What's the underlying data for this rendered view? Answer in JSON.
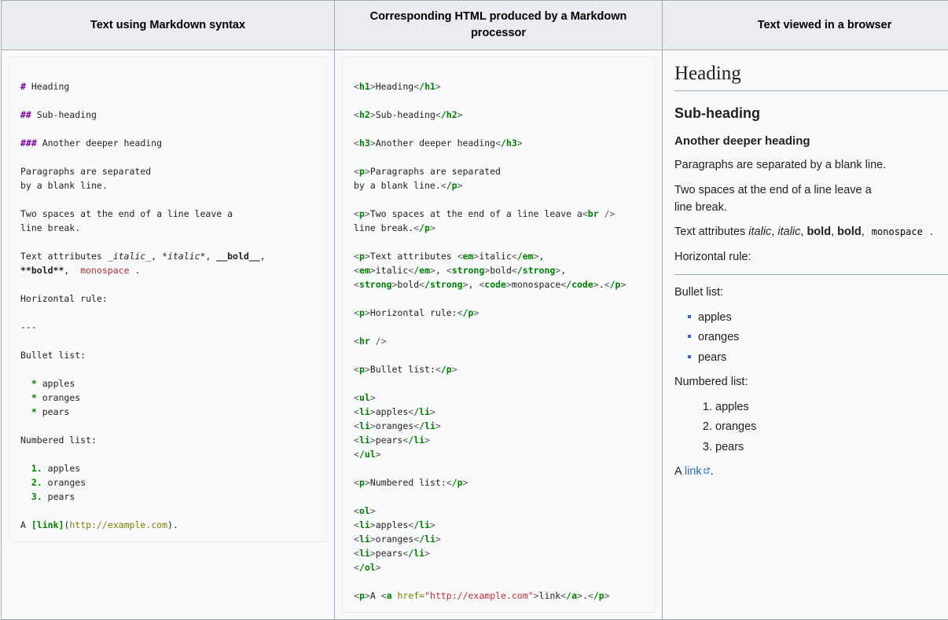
{
  "table": {
    "headers": [
      "Text using Markdown syntax",
      "Corresponding HTML produced by a Markdown processor",
      "Text viewed in a browser"
    ]
  },
  "markdown_source": {
    "heading_h1_marker": "#",
    "heading_h1_text": " Heading",
    "heading_h2_marker": "##",
    "heading_h2_text": " Sub-heading",
    "heading_h3_marker": "###",
    "heading_h3_text": " Another deeper heading",
    "para1_line1": "Paragraphs are separated",
    "para1_line2": "by a blank line.",
    "para2_line1": "Two spaces at the end of a line leave a",
    "para2_line2": "line break.",
    "attrs_prefix": "Text attributes ",
    "attrs_italic_underscore": "_italic_",
    "attrs_sep1": ", ",
    "attrs_italic_star": "*italic*",
    "attrs_sep2": ", ",
    "attrs_bold_underscore": "__bold__",
    "attrs_sep3": ",",
    "attrs_bold_star": "**bold**",
    "attrs_sep4": ", ",
    "attrs_tick_open": "`",
    "attrs_monospace": "monospace",
    "attrs_tick_close": "`",
    "attrs_end": ".",
    "hr_label": "Horizontal rule:",
    "hr_marker": "---",
    "bullet_label": "Bullet list:",
    "bullet_marker": "*",
    "bullet_items": [
      "apples",
      "oranges",
      "pears"
    ],
    "numbered_label": "Numbered list:",
    "numbered_markers": [
      "1.",
      "2.",
      "3."
    ],
    "numbered_items": [
      "apples",
      "oranges",
      "pears"
    ],
    "link_prefix": "A ",
    "link_bracket_open": "[",
    "link_text": "link",
    "link_bracket_close": "]",
    "link_paren_open": "(",
    "link_url": "http://example.com",
    "link_paren_close": ")",
    "link_period": "."
  },
  "html_source": {
    "h1_open": "h1",
    "h1_text": "Heading",
    "h1_close": "/h1",
    "h2_open": "h2",
    "h2_text": "Sub-heading",
    "h2_close": "/h2",
    "h3_open": "h3",
    "h3_text": "Another deeper heading",
    "h3_close": "/h3",
    "p_open": "p",
    "p_close": "/p",
    "para1_line1": "Paragraphs are separated",
    "para1_line2": "by a blank line.",
    "para2_line1": "Two spaces at the end of a line leave a",
    "br_tag": "br",
    "br_slash": " /",
    "para2_line2": "line break.",
    "attrs_prefix": "Text attributes ",
    "em_tag": "em",
    "em_close": "/em",
    "strong_tag": "strong",
    "strong_close": "/strong",
    "code_tag": "code",
    "code_close": "/code",
    "italic_word": "italic",
    "bold_word": "bold",
    "mono_word": "monospace",
    "comma": ", ",
    "period": ".",
    "hr_label": "Horizontal rule:",
    "hr_tag": "hr",
    "bullet_label": "Bullet list:",
    "ul_open": "ul",
    "ul_close": "/ul",
    "li_open": "li",
    "li_close": "/li",
    "list_items": [
      "apples",
      "oranges",
      "pears"
    ],
    "numbered_label": "Numbered list:",
    "ol_open": "ol",
    "ol_close": "/ol",
    "a_tag": "a",
    "a_close": "/a",
    "href_attr": "href=",
    "href_value": "\"http://example.com\"",
    "link_prefix": "A ",
    "link_text": "link"
  },
  "browser_render": {
    "h1": "Heading",
    "h2": "Sub-heading",
    "h3": "Another deeper heading",
    "para1": "Paragraphs are separated by a blank line.",
    "para2_line1": "Two spaces at the end of a line leave a",
    "para2_line2": "line break.",
    "attrs_prefix": "Text attributes ",
    "attrs_italic1": "italic",
    "attrs_sep1": ", ",
    "attrs_italic2": "italic",
    "attrs_sep2": ", ",
    "attrs_bold1": "bold",
    "attrs_sep3": ", ",
    "attrs_bold2": "bold",
    "attrs_sep4": ", ",
    "attrs_mono": "monospace",
    "attrs_end": " .",
    "hr_label": "Horizontal rule:",
    "bullet_label": "Bullet list:",
    "bullet_items": [
      "apples",
      "oranges",
      "pears"
    ],
    "numbered_label": "Numbered list:",
    "numbered_items": [
      "apples",
      "oranges",
      "pears"
    ],
    "link_prefix": "A ",
    "link_text": "link",
    "link_period": "."
  },
  "colors": {
    "header_bg": "#eaecf0",
    "border": "#a2a9b1",
    "cell_bg": "#f8f9fa",
    "md_hash": "#7b0099",
    "md_bullet": "#008000",
    "html_tag": "#008000",
    "html_attr": "#808000",
    "html_value": "#c03030",
    "link_blue": "#3366cc",
    "code_red": "#b03030"
  }
}
